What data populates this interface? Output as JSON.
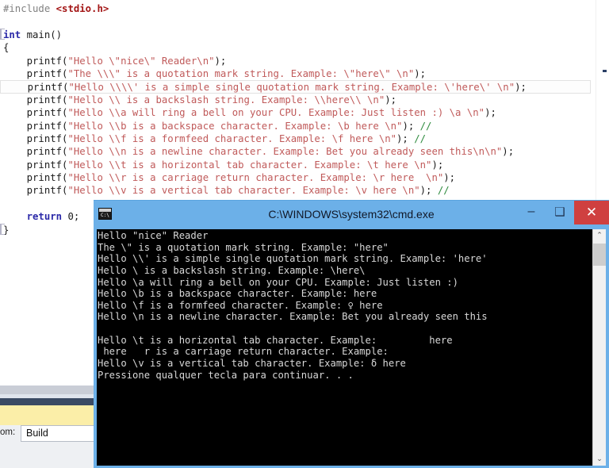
{
  "editor": {
    "code_lines": [
      {
        "type": "code",
        "fold": false,
        "current": false,
        "spans": [
          {
            "cls": "c-pre",
            "t": "#include "
          },
          {
            "cls": "c-inc",
            "t": "<stdio.h>"
          }
        ]
      },
      {
        "type": "blank"
      },
      {
        "type": "code",
        "fold": true,
        "current": false,
        "spans": [
          {
            "cls": "c-kw",
            "t": "int "
          },
          {
            "cls": "c-plain",
            "t": "main()"
          }
        ]
      },
      {
        "type": "code",
        "fold": false,
        "current": false,
        "spans": [
          {
            "cls": "c-plain",
            "t": "{"
          }
        ]
      },
      {
        "type": "code",
        "fold": false,
        "current": false,
        "spans": [
          {
            "cls": "c-plain",
            "t": "    printf("
          },
          {
            "cls": "c-str",
            "t": "\"Hello \\\"nice\\\" Reader\\n\""
          },
          {
            "cls": "c-plain",
            "t": ");"
          }
        ]
      },
      {
        "type": "code",
        "fold": false,
        "current": false,
        "spans": [
          {
            "cls": "c-plain",
            "t": "    printf("
          },
          {
            "cls": "c-str",
            "t": "\"The \\\\\\\" is a quotation mark string. Example: \\\"here\\\" \\n\""
          },
          {
            "cls": "c-plain",
            "t": ");"
          }
        ]
      },
      {
        "type": "code",
        "fold": false,
        "current": true,
        "spans": [
          {
            "cls": "c-plain",
            "t": "    printf("
          },
          {
            "cls": "c-str",
            "t": "\"Hello \\\\\\\\' is a simple single quotation mark string. Example: \\'here\\' \\n\""
          },
          {
            "cls": "c-plain",
            "t": ");"
          }
        ]
      },
      {
        "type": "code",
        "fold": false,
        "current": false,
        "spans": [
          {
            "cls": "c-plain",
            "t": "    printf("
          },
          {
            "cls": "c-str",
            "t": "\"Hello \\\\ is a backslash string. Example: \\\\here\\\\ \\n\""
          },
          {
            "cls": "c-plain",
            "t": ");"
          }
        ]
      },
      {
        "type": "code",
        "fold": false,
        "current": false,
        "spans": [
          {
            "cls": "c-plain",
            "t": "    printf("
          },
          {
            "cls": "c-str",
            "t": "\"Hello \\\\a will ring a bell on your CPU. Example: Just listen :) \\a \\n\""
          },
          {
            "cls": "c-plain",
            "t": ");"
          }
        ]
      },
      {
        "type": "code",
        "fold": false,
        "current": false,
        "spans": [
          {
            "cls": "c-plain",
            "t": "    printf("
          },
          {
            "cls": "c-str",
            "t": "\"Hello \\\\b is a backspace character. Example: \\b here \\n\""
          },
          {
            "cls": "c-plain",
            "t": "); "
          },
          {
            "cls": "c-cmt",
            "t": "//"
          }
        ]
      },
      {
        "type": "code",
        "fold": false,
        "current": false,
        "spans": [
          {
            "cls": "c-plain",
            "t": "    printf("
          },
          {
            "cls": "c-str",
            "t": "\"Hello \\\\f is a formfeed character. Example: \\f here \\n\""
          },
          {
            "cls": "c-plain",
            "t": "); "
          },
          {
            "cls": "c-cmt",
            "t": "//"
          }
        ]
      },
      {
        "type": "code",
        "fold": false,
        "current": false,
        "spans": [
          {
            "cls": "c-plain",
            "t": "    printf("
          },
          {
            "cls": "c-str",
            "t": "\"Hello \\\\n is a newline character. Example: Bet you already seen this\\n\\n\""
          },
          {
            "cls": "c-plain",
            "t": ");"
          }
        ]
      },
      {
        "type": "code",
        "fold": false,
        "current": false,
        "spans": [
          {
            "cls": "c-plain",
            "t": "    printf("
          },
          {
            "cls": "c-str",
            "t": "\"Hello \\\\t is a horizontal tab character. Example: \\t here \\n\""
          },
          {
            "cls": "c-plain",
            "t": ");"
          }
        ]
      },
      {
        "type": "code",
        "fold": false,
        "current": false,
        "spans": [
          {
            "cls": "c-plain",
            "t": "    printf("
          },
          {
            "cls": "c-str",
            "t": "\"Hello \\\\r is a carriage return character. Example: \\r here  \\n\""
          },
          {
            "cls": "c-plain",
            "t": ");"
          }
        ]
      },
      {
        "type": "code",
        "fold": false,
        "current": false,
        "spans": [
          {
            "cls": "c-plain",
            "t": "    printf("
          },
          {
            "cls": "c-str",
            "t": "\"Hello \\\\v is a vertical tab character. Example: \\v here \\n\""
          },
          {
            "cls": "c-plain",
            "t": "); "
          },
          {
            "cls": "c-cmt",
            "t": "//"
          }
        ]
      },
      {
        "type": "blank"
      },
      {
        "type": "code",
        "fold": false,
        "current": false,
        "spans": [
          {
            "cls": "c-kw",
            "t": "    return "
          },
          {
            "cls": "c-plain",
            "t": "0;"
          }
        ]
      },
      {
        "type": "code",
        "fold": true,
        "current": false,
        "spans": [
          {
            "cls": "c-plain",
            "t": "}"
          }
        ]
      }
    ]
  },
  "bottom_panel": {
    "field_label": "om:",
    "field_value": "Build"
  },
  "console": {
    "title": "C:\\WINDOWS\\system32\\cmd.exe",
    "icon_name": "cmd-icon",
    "icon_glyph": "C:\\",
    "window_buttons": {
      "minimize": "–",
      "maximize": "❑",
      "close": "✕"
    },
    "scrollbar": {
      "up_arrow": "⌃",
      "down_arrow": "⌄"
    },
    "output_lines": [
      "Hello \"nice\" Reader",
      "The \\\" is a quotation mark string. Example: \"here\"",
      "Hello \\\\' is a simple single quotation mark string. Example: 'here'",
      "Hello \\ is a backslash string. Example: \\here\\",
      "Hello \\a will ring a bell on your CPU. Example: Just listen :)",
      "Hello \\b is a backspace character. Example: here",
      "Hello \\f is a formfeed character. Example: ♀ here",
      "Hello \\n is a newline character. Example: Bet you already seen this",
      "",
      "Hello \\t is a horizontal tab character. Example:         here",
      " here   r is a carriage return character. Example:",
      "Hello \\v is a vertical tab character. Example: δ here",
      "Pressione qualquer tecla para continuar. . ."
    ]
  },
  "colors": {
    "console_chrome_blue": "#6cb0e8",
    "close_button_red": "#cf4040",
    "console_background": "#000000",
    "console_text": "#d8d8d8",
    "string_literal": "#c05a5a",
    "keyword_blue": "#2b29a8",
    "comment_green": "#2e8b3e",
    "include_red": "#a31515",
    "preprocessor_grey": "#808080",
    "panel_yellow": "#fbeea8",
    "panel_darkbar": "#3a4a63"
  }
}
